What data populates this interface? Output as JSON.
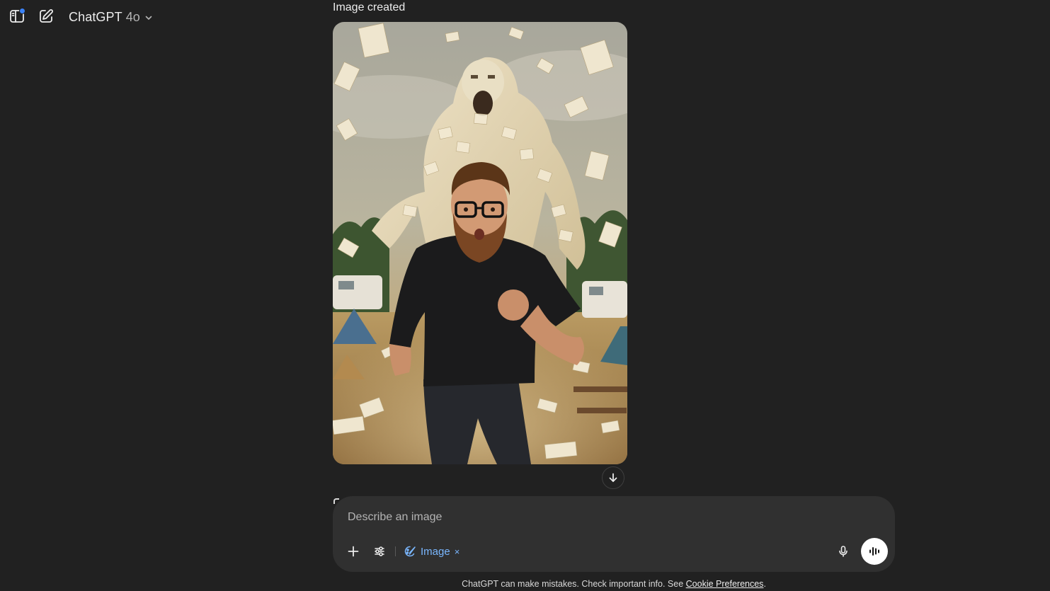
{
  "header": {
    "model_name": "ChatGPT",
    "model_version": "4o",
    "sidebar_has_notification": true
  },
  "conversation": {
    "image_label": "Image created",
    "image_description": "A bearded man with glasses in a black t-shirt sprinting away from a giant roaring monster made of paper sheets, with papers flying everywhere at a campsite with RVs and tents."
  },
  "composer": {
    "placeholder": "Describe an image",
    "value": "",
    "active_tool_label": "Image",
    "active_tool_remove": "×"
  },
  "footer": {
    "disclaimer": "ChatGPT can make mistakes. Check important info. See",
    "cookie_link": "Cookie Preferences",
    "trailing": "."
  },
  "colors": {
    "background": "#212121",
    "composer": "#303030",
    "accent_blue": "#7ab7ff",
    "notification": "#3b82f6"
  },
  "icons": {
    "sidebar_toggle": "sidebar-icon",
    "new_chat": "compose-icon",
    "model_chevron": "chevron-down-icon",
    "scroll_down": "arrow-down-icon",
    "add": "plus-icon",
    "tools": "sliders-icon",
    "image_tool": "image-brush-icon",
    "mic": "microphone-icon",
    "voice": "voice-waveform-icon"
  }
}
